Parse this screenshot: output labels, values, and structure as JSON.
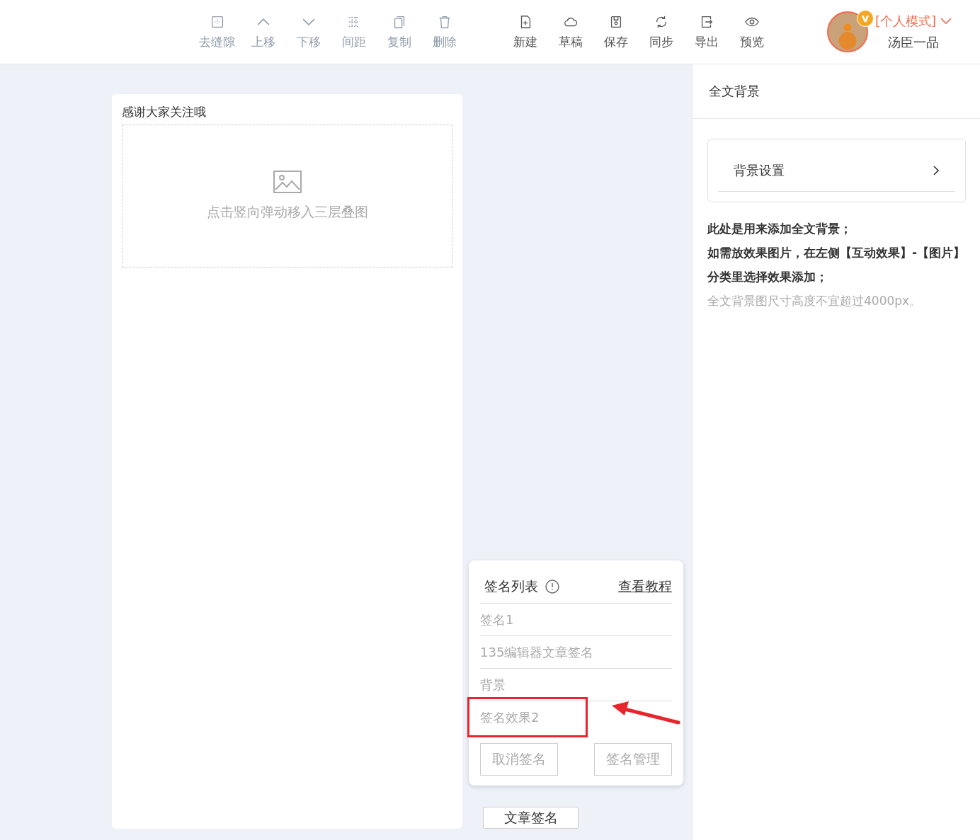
{
  "toolbar": {
    "tools": [
      {
        "label": "去缝隙",
        "disabled": true
      },
      {
        "label": "上移",
        "disabled": true
      },
      {
        "label": "下移",
        "disabled": true
      },
      {
        "label": "间距",
        "disabled": true
      },
      {
        "label": "复制",
        "disabled": true
      },
      {
        "label": "删除",
        "disabled": true
      },
      {
        "label": "新建",
        "disabled": false
      },
      {
        "label": "草稿",
        "disabled": false
      },
      {
        "label": "保存",
        "disabled": false
      },
      {
        "label": "同步",
        "disabled": false
      },
      {
        "label": "导出",
        "disabled": false
      },
      {
        "label": "预览",
        "disabled": false
      }
    ]
  },
  "user": {
    "badge": "v",
    "mode": "[个人模式]",
    "mode_active": true,
    "name": "汤臣一品"
  },
  "canvas": {
    "title": "感谢大家关注哦",
    "placeholder": "点击竖向弹动移入三层叠图"
  },
  "signature_panel": {
    "title": "签名列表",
    "tutorial_link": "查看教程",
    "items": [
      {
        "label": "签名1",
        "highlighted": false
      },
      {
        "label": "135编辑器文章签名",
        "highlighted": false
      },
      {
        "label": "背景",
        "highlighted": false
      },
      {
        "label": "签名效果2",
        "highlighted": true
      }
    ],
    "buttons": [
      "取消签名",
      "签名管理"
    ]
  },
  "signature_toggle": "文章签名",
  "sidebar": {
    "title": "全文背景",
    "setting": "背景设置",
    "notes": [
      {
        "text": "此处是用来添加全文背景；",
        "emphasis": true
      },
      {
        "text": "如需放效果图片，在左侧【互动效果】-【图片】分类里选择效果添加；",
        "emphasis": true
      },
      {
        "text": "全文背景图尺寸高度不宜超过4000px。",
        "emphasis": false
      }
    ]
  }
}
